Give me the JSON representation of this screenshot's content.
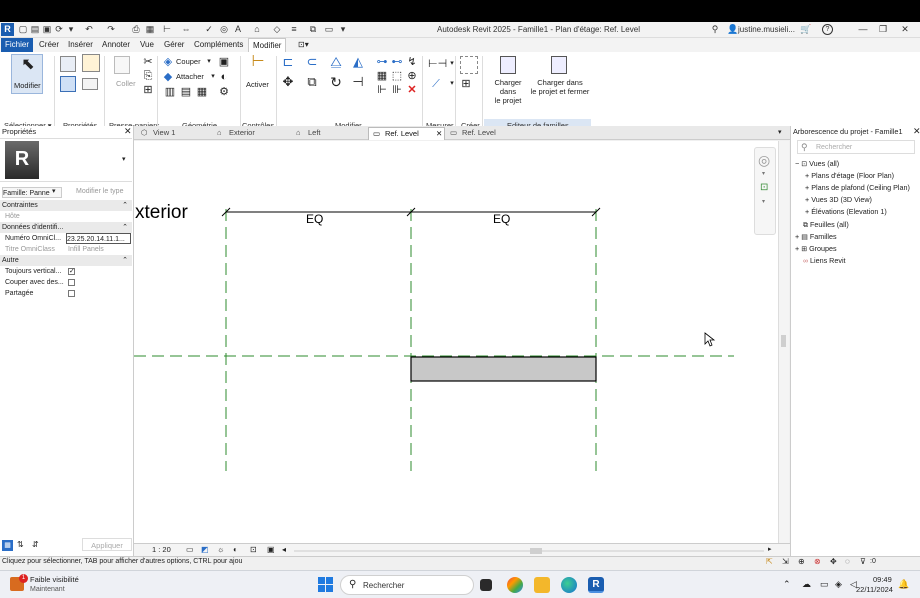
{
  "app": {
    "title": "Autodesk Revit 2025 - Famille1 - Plan d'étage: Ref. Level",
    "logo": "R",
    "user": "justine.musieli...",
    "colors": {
      "accent": "#1a5db0",
      "ref_plane": "#2e8b2e",
      "extrusion": "#c8c8c8"
    }
  },
  "ribbon": {
    "tabs": [
      "Fichier",
      "Créer",
      "Insérer",
      "Annoter",
      "Vue",
      "Gérer",
      "Compléments",
      "Modifier",
      "⊡▾"
    ],
    "active_tab": "Modifier",
    "buttons": {
      "modifier": "Modifier",
      "coller": "Coller",
      "couper": "Couper",
      "attacher": "Attacher",
      "activer": "Activer",
      "charger_projet": "Charger dans\nle projet",
      "charger_fermer": "Charger dans\nle projet et fermer"
    },
    "groups": [
      "Sélectionner ▾",
      "Propriétés",
      "Presse-papiers",
      "Géométrie",
      "Contrôles",
      "Modifier",
      "Mesurer",
      "Créer",
      "Editeur de familles"
    ]
  },
  "properties": {
    "title": "Propriétés",
    "family_label": "Famille: Panne",
    "edit_type": "Modifier le type",
    "apply": "Appliquer",
    "sections": [
      {
        "label": "Contraintes",
        "rows": [
          {
            "name": "Hôte",
            "value": ""
          }
        ]
      },
      {
        "label": "Données d'identifi...",
        "rows": [
          {
            "name": "Numéro OmniCl...",
            "value": "23.25.20.14.11.1..."
          },
          {
            "name": "Titre OmniClass",
            "value": "Infill Panels"
          }
        ]
      },
      {
        "label": "Autre",
        "rows": [
          {
            "name": "Toujours vertical...",
            "checked": true
          },
          {
            "name": "Couper avec des...",
            "checked": false
          },
          {
            "name": "Partagée",
            "checked": false
          }
        ]
      }
    ]
  },
  "view_tabs": [
    "View 1",
    "Exterior",
    "Left",
    "Ref. Level",
    "Ref. Level"
  ],
  "active_view_tab": "Ref. Level",
  "canvas": {
    "elevation_label": "xterior",
    "dim_labels": [
      "EQ",
      "EQ"
    ],
    "scale": "1 : 20"
  },
  "browser": {
    "title": "Arborescence du projet - Famille1",
    "search_placeholder": "Rechercher",
    "items": [
      {
        "label": "Vues (all)",
        "level": 0,
        "expander": "−"
      },
      {
        "label": "Plans d'étage (Floor Plan)",
        "level": 1,
        "expander": "+"
      },
      {
        "label": "Plans de plafond (Ceiling Plan)",
        "level": 1,
        "expander": "+"
      },
      {
        "label": "Vues 3D (3D View)",
        "level": 1,
        "expander": "+"
      },
      {
        "label": "Élévations (Elevation 1)",
        "level": 1,
        "expander": "+"
      },
      {
        "label": "Feuilles (all)",
        "level": 0,
        "expander": ""
      },
      {
        "label": "Familles",
        "level": 0,
        "expander": "+"
      },
      {
        "label": "Groupes",
        "level": 0,
        "expander": "+"
      },
      {
        "label": "Liens Revit",
        "level": 0,
        "expander": ""
      }
    ]
  },
  "status": {
    "message": "Cliquez pour sélectionner, TAB pour afficher d'autres options,  CTRL pour ajou",
    "filter_count": ":0"
  },
  "taskbar": {
    "notif_title": "Faible visibilité",
    "notif_sub": "Maintenant",
    "notif_badge": "1",
    "search_placeholder": "Rechercher",
    "time": "09:49",
    "date": "22/11/2024"
  }
}
